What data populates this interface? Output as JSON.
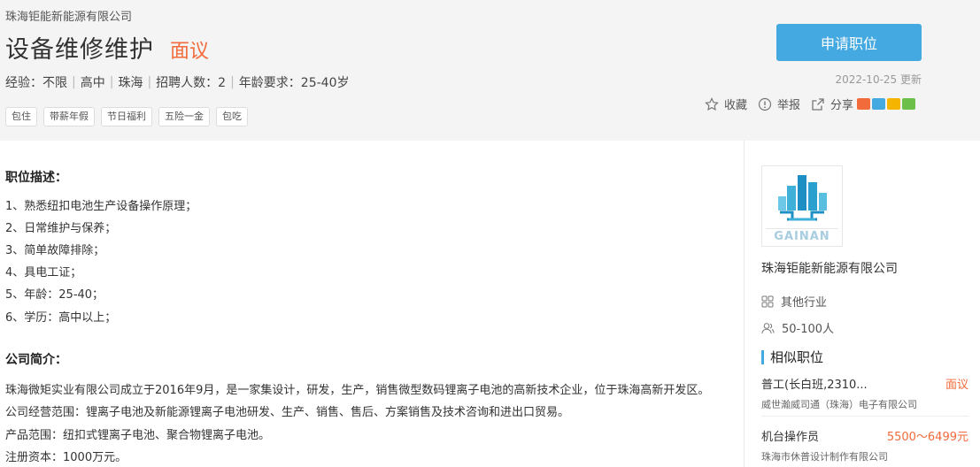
{
  "header": {
    "company_small": "珠海钜能新能源有限公司",
    "job_title": "设备维修维护",
    "salary": "面议",
    "meta": [
      "经验：不限",
      "高中",
      "珠海",
      "招聘人数：2",
      "年龄要求：25-40岁"
    ],
    "tags": [
      "包住",
      "带薪年假",
      "节日福利",
      "五险一金",
      "包吃"
    ],
    "apply_label": "申请职位",
    "update_text": "2022-10-25 更新",
    "actions": {
      "favorite": "收藏",
      "report": "举报",
      "share": "分享"
    },
    "share_colors": [
      "#f26b3a",
      "#44a9e0",
      "#f5b400",
      "#6cc04a"
    ]
  },
  "description": {
    "title": "职位描述：",
    "lines": [
      "1、熟悉纽扣电池生产设备操作原理；",
      "2、日常维护与保养；",
      "3、简单故障排除；",
      "4、具电工证；",
      "5、年龄：25-40；",
      "6、学历：高中以上；"
    ]
  },
  "intro": {
    "title": "公司简介：",
    "lines": [
      "珠海微矩实业有限公司成立于2016年9月，是一家集设计，研发，生产，销售微型数码锂离子电池的高新技术企业，位于珠海高新开发区。",
      "公司经营范围：锂离子电池及新能源锂离子电池研发、生产、销售、售后、方案销售及技术咨询和进出口贸易。",
      "产品范围：纽扣式锂离子电池、聚合物锂离子电池。",
      "注册资本：1000万元。"
    ]
  },
  "sidebar": {
    "logo_text": "GAINAN",
    "company_name": "珠海钜能新能源有限公司",
    "industry": "其他行业",
    "size": "50-100人",
    "similar_title": "相似职位",
    "similar": [
      {
        "name": "普工(长白班,2310...",
        "salary": "面议",
        "company": "威世瀚威司通（珠海）电子有限公司"
      },
      {
        "name": "机台操作员",
        "salary": "5500～6499元",
        "company": "珠海市休普设计制作有限公司"
      }
    ]
  },
  "colors": {
    "accent": "#44a9e0",
    "salary": "#f26b3a"
  }
}
